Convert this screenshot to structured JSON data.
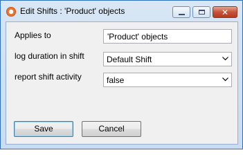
{
  "window": {
    "title": "Edit Shifts : 'Product' objects"
  },
  "form": {
    "applies_to": {
      "label": "Applies to",
      "value": "'Product' objects"
    },
    "log_duration": {
      "label": "log duration in shift",
      "value": "Default Shift"
    },
    "report_activity": {
      "label": "report shift activity",
      "value": "false"
    }
  },
  "buttons": {
    "save": "Save",
    "cancel": "Cancel"
  }
}
